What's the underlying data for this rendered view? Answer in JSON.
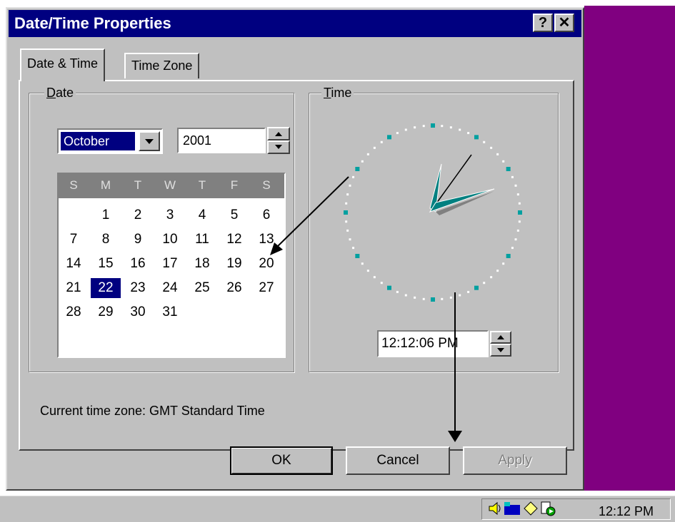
{
  "window": {
    "title": "Date/Time Properties",
    "help_label": "?",
    "close_label": "✕"
  },
  "tabs": [
    {
      "label": "Date & Time",
      "active": true
    },
    {
      "label": "Time Zone",
      "active": false
    }
  ],
  "date_group": {
    "label": "Date",
    "month": "October",
    "year": "2001",
    "weekdays": [
      "S",
      "M",
      "T",
      "W",
      "T",
      "F",
      "S"
    ],
    "weeks": [
      [
        "",
        "1",
        "2",
        "3",
        "4",
        "5",
        "6"
      ],
      [
        "7",
        "8",
        "9",
        "10",
        "11",
        "12",
        "13"
      ],
      [
        "14",
        "15",
        "16",
        "17",
        "18",
        "19",
        "20"
      ],
      [
        "21",
        "22",
        "23",
        "24",
        "25",
        "26",
        "27"
      ],
      [
        "28",
        "29",
        "30",
        "31",
        "",
        "",
        ""
      ]
    ],
    "selected_day": "22"
  },
  "time_group": {
    "label": "Time",
    "time_value": "12:12:06 PM"
  },
  "timezone_text": "Current time zone:  GMT Standard Time",
  "buttons": {
    "ok": "OK",
    "cancel": "Cancel",
    "apply": "Apply"
  },
  "taskbar": {
    "clock": "12:12 PM"
  },
  "colors": {
    "title_bar": "#000080",
    "desktop": "#800080",
    "clock_hand": "#008080",
    "face": "#c0c0c0"
  }
}
